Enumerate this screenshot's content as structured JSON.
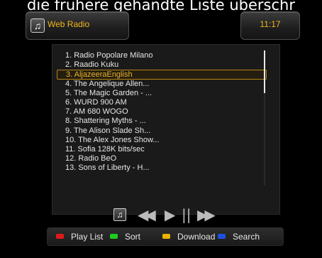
{
  "caption": "die frühere gehandte Liste überschr",
  "header": {
    "title": "Web Radio",
    "clock": "11:17",
    "icon": "music-note-icon"
  },
  "playlist": {
    "selected_index": 2,
    "items": [
      "1. Radio Popolare Milano",
      "2. Raadio Kuku",
      "3. AljazeeraEnglish",
      "4. The Angelique Allen...",
      "5. The Magic Garden - ...",
      "6. WURD 900 AM",
      "7. AM 680 WOGO",
      "8. Shattering Myths - ...",
      "9. The Alison Slade Sh...",
      "10. The Alex Jones Show...",
      "11. Sofia 128K bits/sec",
      "12. Radio BeO",
      "13. Sons of Liberty - H..."
    ]
  },
  "controls": {
    "rewind": "◀◀",
    "play": "▶",
    "pause": "||",
    "forward": "▶▶"
  },
  "footer": {
    "buttons": [
      {
        "label": "Play List",
        "color": "#e01a1a"
      },
      {
        "label": "Sort",
        "color": "#1ecb1e"
      },
      {
        "label": "Download",
        "color": "#e8b400"
      },
      {
        "label": "Search",
        "color": "#1e50e0"
      }
    ]
  }
}
